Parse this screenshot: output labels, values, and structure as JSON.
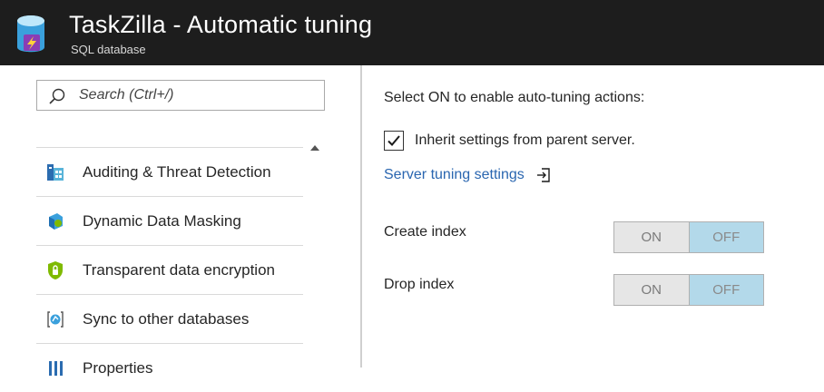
{
  "header": {
    "title": "TaskZilla - Automatic tuning",
    "subtitle": "SQL database",
    "icon": "sql-database-icon"
  },
  "sidebar": {
    "search": {
      "placeholder": "Search (Ctrl+/)",
      "value": "",
      "icon": "search-icon"
    },
    "items": [
      {
        "label": "Auditing & Threat Detection",
        "icon": "auditing-icon"
      },
      {
        "label": "Dynamic Data Masking",
        "icon": "data-masking-icon"
      },
      {
        "label": "Transparent data encryption",
        "icon": "shield-icon"
      },
      {
        "label": "Sync to other databases",
        "icon": "sync-icon"
      },
      {
        "label": "Properties",
        "icon": "properties-icon"
      }
    ]
  },
  "main": {
    "heading": "Select ON to enable auto-tuning actions:",
    "inherit": {
      "label": "Inherit settings from parent server.",
      "checked": true
    },
    "link": "Server tuning settings",
    "settings": [
      {
        "label": "Create index",
        "on_label": "ON",
        "off_label": "OFF",
        "selected": "OFF"
      },
      {
        "label": "Drop index",
        "on_label": "ON",
        "off_label": "OFF",
        "selected": "OFF"
      }
    ]
  },
  "colors": {
    "header_bg": "#1d1d1d",
    "link": "#2a66b0",
    "toggle_selected": "#b3d9ea",
    "toggle_unselected": "#e6e6e6"
  }
}
